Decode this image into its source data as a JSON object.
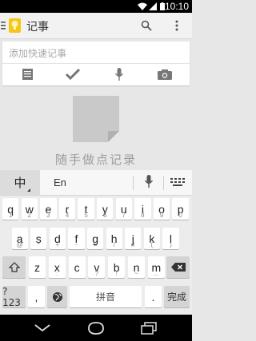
{
  "status_bar": {
    "time": "10:10",
    "icons": [
      "wifi-icon",
      "signal-icon",
      "battery-icon"
    ]
  },
  "action_bar": {
    "title": "记事",
    "icons": [
      "menu-icon",
      "app-logo-icon",
      "search-icon",
      "overflow-icon"
    ]
  },
  "quick_note": {
    "placeholder": "添加快速记事",
    "tools": [
      "list-icon",
      "checkmark-icon",
      "microphone-icon",
      "camera-icon"
    ]
  },
  "empty_state": {
    "text": "随手做点记录",
    "icon": "note-icon"
  },
  "keyboard": {
    "mode_zh": "中",
    "mode_en": "En",
    "row1": [
      {
        "k": "q",
        "s": "1"
      },
      {
        "k": "w",
        "s": "2"
      },
      {
        "k": "e",
        "s": "3"
      },
      {
        "k": "r",
        "s": "4"
      },
      {
        "k": "t",
        "s": "5"
      },
      {
        "k": "y",
        "s": "6"
      },
      {
        "k": "u",
        "s": "7"
      },
      {
        "k": "i",
        "s": "8"
      },
      {
        "k": "o",
        "s": "9"
      },
      {
        "k": "p",
        "s": "0"
      }
    ],
    "row2": [
      {
        "k": "a",
        "s": "@"
      },
      {
        "k": "s",
        "s": "*"
      },
      {
        "k": "d",
        "s": "+"
      },
      {
        "k": "f",
        "s": "-"
      },
      {
        "k": "g",
        "s": "="
      },
      {
        "k": "h",
        "s": "/"
      },
      {
        "k": "j",
        "s": "#"
      },
      {
        "k": "k",
        "s": "("
      },
      {
        "k": "l",
        "s": ")"
      }
    ],
    "row3": [
      {
        "k": "z",
        "s": "'"
      },
      {
        "k": "x",
        "s": ":"
      },
      {
        "k": "c",
        "s": "\""
      },
      {
        "k": "v",
        "s": "?"
      },
      {
        "k": "b",
        "s": "!"
      },
      {
        "k": "n",
        "s": "~"
      },
      {
        "k": "m",
        "s": "…"
      }
    ],
    "symbols_label": "?123",
    "comma_label": ",",
    "space_label": "拼音",
    "period_label": ".",
    "done_label": "完成"
  },
  "colors": {
    "accent": "#f5c518",
    "background": "#e7e7e7",
    "keyboard": "#ececec"
  }
}
